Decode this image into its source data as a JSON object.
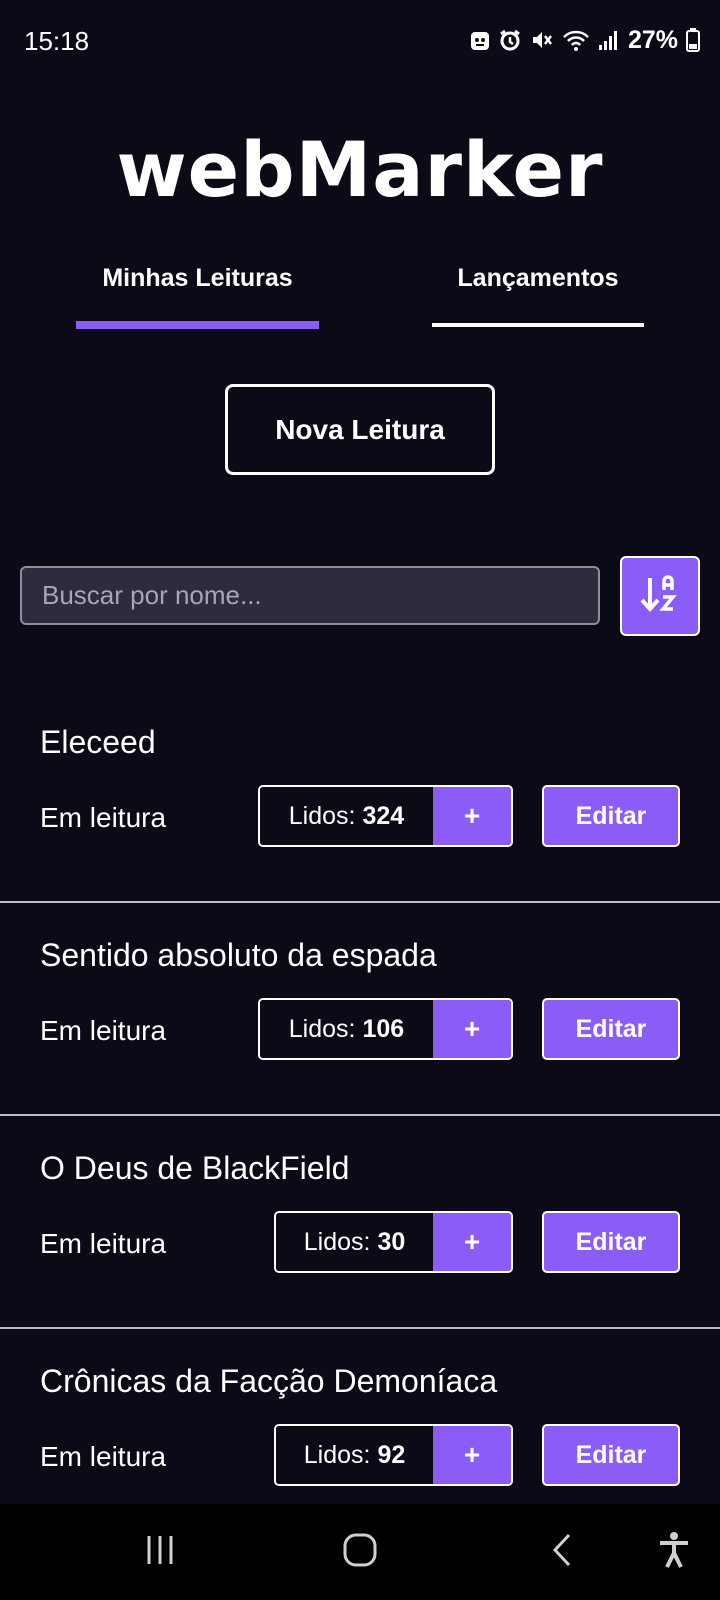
{
  "status_bar": {
    "time": "15:18",
    "battery_percent": "27%",
    "icons": [
      "android-debug-icon",
      "alarm-icon",
      "mute-icon",
      "wifi-icon",
      "signal-icon",
      "battery-icon"
    ]
  },
  "app": {
    "logo_text": "webMarker"
  },
  "tabs": [
    {
      "label": "Minhas Leituras",
      "active": true
    },
    {
      "label": "Lançamentos",
      "active": false
    }
  ],
  "new_reading_label": "Nova Leitura",
  "search": {
    "placeholder": "Buscar por nome...",
    "value": ""
  },
  "sort_button_icon": "sort-az-icon",
  "items": [
    {
      "title": "Eleceed",
      "status": "Em leitura",
      "read_label": "Lidos:",
      "read_count": "324",
      "plus_label": "+",
      "edit_label": "Editar"
    },
    {
      "title": "Sentido absoluto da espada",
      "status": "Em leitura",
      "read_label": "Lidos:",
      "read_count": "106",
      "plus_label": "+",
      "edit_label": "Editar"
    },
    {
      "title": "O Deus de BlackField",
      "status": "Em leitura",
      "read_label": "Lidos:",
      "read_count": "30",
      "plus_label": "+",
      "edit_label": "Editar"
    },
    {
      "title": "Crônicas da Facção Demoníaca",
      "status": "Em leitura",
      "read_label": "Lidos:",
      "read_count": "92",
      "plus_label": "+",
      "edit_label": "Editar"
    }
  ],
  "nav_bar": {
    "buttons": [
      "recents-icon",
      "home-icon",
      "back-icon",
      "accessibility-icon"
    ]
  },
  "colors": {
    "background": "#0c0a17",
    "accent": "#8b5cf6",
    "input_background": "#2d2b3d",
    "text": "#ffffff",
    "divider": "#bdbcc6"
  }
}
